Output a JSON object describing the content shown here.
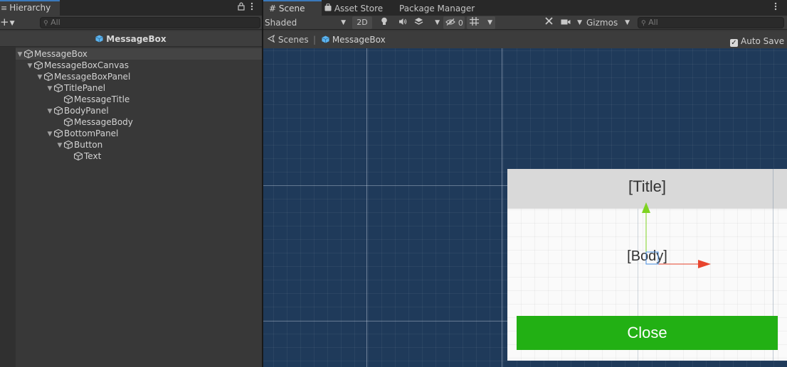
{
  "hierarchy": {
    "tab_label": "Hierarchy",
    "tab_glyph": "≡",
    "search_placeholder": "All",
    "scene_header": "MessageBox",
    "tree": [
      {
        "label": "MessageBox",
        "depth": 0,
        "expanded": true,
        "selected": true
      },
      {
        "label": "MessageBoxCanvas",
        "depth": 1,
        "expanded": true
      },
      {
        "label": "MessageBoxPanel",
        "depth": 2,
        "expanded": true
      },
      {
        "label": "TitlePanel",
        "depth": 3,
        "expanded": true
      },
      {
        "label": "MessageTitle",
        "depth": 4,
        "expanded": null
      },
      {
        "label": "BodyPanel",
        "depth": 3,
        "expanded": true
      },
      {
        "label": "MessageBody",
        "depth": 4,
        "expanded": null
      },
      {
        "label": "BottomPanel",
        "depth": 3,
        "expanded": true
      },
      {
        "label": "Button",
        "depth": 4,
        "expanded": true
      },
      {
        "label": "Text",
        "depth": 5,
        "expanded": null
      }
    ]
  },
  "scene_tabs": {
    "scene": "Scene",
    "asset_store": "Asset Store",
    "package_manager": "Package Manager"
  },
  "scene_toolbar": {
    "shading_mode": "Shaded",
    "mode_2d": "2D",
    "hidden_count": "0",
    "gizmos": "Gizmos",
    "search_placeholder": "All"
  },
  "breadcrumbs": {
    "scenes": "Scenes",
    "current": "MessageBox",
    "auto_save": "Auto Save",
    "auto_save_checked": true
  },
  "viewport": {
    "message_title": "[Title]",
    "message_body": "[Body]",
    "button_text": "Close"
  },
  "colors": {
    "tab_accent": "#3a79bb",
    "prefab_cube": "#5cb4f0",
    "viewport_bg": "#1f3a5a",
    "button_green": "#22b014",
    "gizmo_y": "#7ed321",
    "gizmo_x": "#e8452e"
  }
}
